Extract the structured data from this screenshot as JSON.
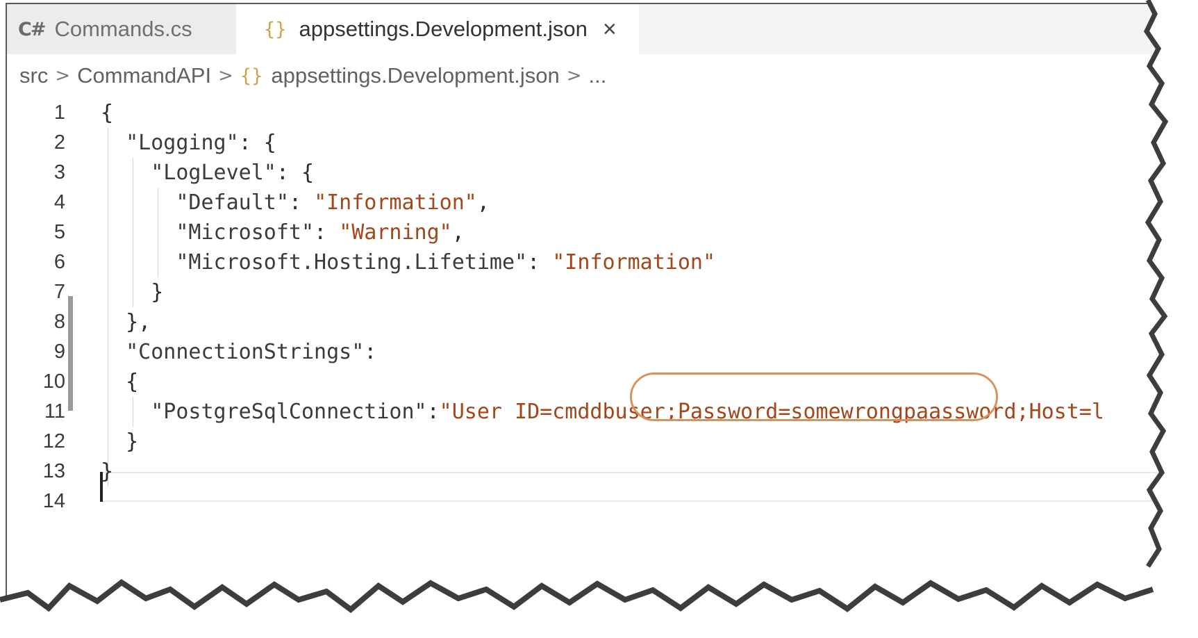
{
  "tabs": [
    {
      "label": "Commands.cs",
      "icon": "csharp-icon",
      "active": false
    },
    {
      "label": "appsettings.Development.json",
      "icon": "json-braces-icon",
      "active": true,
      "close": "×"
    }
  ],
  "csharp_glyph": "C#",
  "braces_glyph": "{}",
  "breadcrumb": {
    "items": [
      "src",
      "CommandAPI",
      "appsettings.Development.json",
      "..."
    ],
    "separator": ">"
  },
  "editor": {
    "lines": [
      {
        "n": "1",
        "text": "{"
      },
      {
        "n": "2",
        "text": "  \"Logging\": {"
      },
      {
        "n": "3",
        "text": "    \"LogLevel\": {"
      },
      {
        "n": "4",
        "text": "      \"Default\": \"Information\","
      },
      {
        "n": "5",
        "text": "      \"Microsoft\": \"Warning\","
      },
      {
        "n": "6",
        "text": "      \"Microsoft.Hosting.Lifetime\": \"Information\""
      },
      {
        "n": "7",
        "text": "    }"
      },
      {
        "n": "8",
        "text": "  },"
      },
      {
        "n": "9",
        "text": "  \"ConnectionStrings\":"
      },
      {
        "n": "10",
        "text": "  {"
      },
      {
        "n": "11",
        "text": "    \"PostgreSqlConnection\":\"User ID=cmddbuser;Password=somewrongpaassword;Host=l"
      },
      {
        "n": "12",
        "text": "  }"
      },
      {
        "n": "13",
        "text": "}"
      },
      {
        "n": "14",
        "text": ""
      }
    ]
  },
  "colors": {
    "string": "#a3461a",
    "highlight": "#d9925a",
    "braces_icon": "#cfa24e"
  }
}
